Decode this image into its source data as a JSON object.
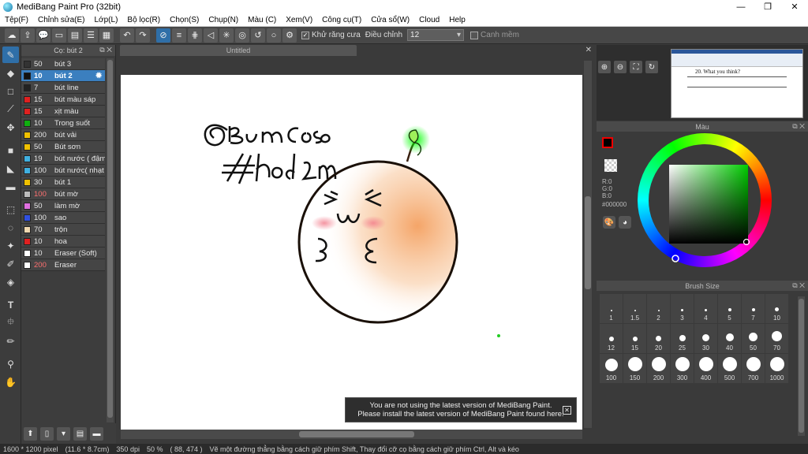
{
  "window": {
    "title": "MediBang Paint Pro (32bit)",
    "minimize": "—",
    "maximize": "❐",
    "close": "✕"
  },
  "menu": [
    "Tệp(F)",
    "Chỉnh sửa(E)",
    "Lớp(L)",
    "Bộ lọc(R)",
    "Chọn(S)",
    "Chụp(N)",
    "Màu (C)",
    "Xem(V)",
    "Công cụ(T)",
    "Cửa sổ(W)",
    "Cloud",
    "Help"
  ],
  "toolbar": {
    "antialias_label": "Khử răng cưa",
    "correction_label": "Điều chỉnh",
    "correction_value": "12",
    "edge_label": "Canh mềm"
  },
  "brush_panel": {
    "title": "Cọ: bút 2",
    "brushes": [
      {
        "size": "50",
        "name": "bút 3",
        "color": "#333333"
      },
      {
        "size": "10",
        "name": "bút 2",
        "color": "#111111",
        "selected": true
      },
      {
        "size": "7",
        "name": "bút line",
        "color": "#222222"
      },
      {
        "size": "15",
        "name": "bút màu sáp",
        "color": "#e02020"
      },
      {
        "size": "15",
        "name": "xịt màu",
        "color": "#e02020"
      },
      {
        "size": "10",
        "name": "Trong suốt",
        "color": "#10b010"
      },
      {
        "size": "200",
        "name": "bút vải",
        "color": "#f0c000"
      },
      {
        "size": "50",
        "name": "Bút sơn",
        "color": "#f0c000"
      },
      {
        "size": "19",
        "name": "bút nước ( đậm",
        "color": "#40b0e0"
      },
      {
        "size": "100",
        "name": "bút nước( nhạt",
        "color": "#40b0e0"
      },
      {
        "size": "30",
        "name": "bút 1",
        "color": "#f0c000"
      },
      {
        "size": "100",
        "name": "bút mờ",
        "color": "#bbbbbb",
        "red_size": true
      },
      {
        "size": "50",
        "name": "làm mờ",
        "color": "#e070e0"
      },
      {
        "size": "100",
        "name": "sao",
        "color": "#3050e0"
      },
      {
        "size": "70",
        "name": "trộn",
        "color": "#f0d8b0"
      },
      {
        "size": "10",
        "name": "hoa",
        "color": "#e02020"
      },
      {
        "size": "10",
        "name": "Eraser (Soft)",
        "color": "#ffffff"
      },
      {
        "size": "200",
        "name": "Eraser",
        "color": "#ffffff",
        "red_size": true
      }
    ]
  },
  "document": {
    "tab": "Untitled"
  },
  "notice": {
    "line1": "You are not using the latest version of MediBang Paint.",
    "line2": "Please install the latest version of MediBang Paint found here."
  },
  "navigator": {
    "preview_line": "20. What you think?"
  },
  "color_panel": {
    "title": "Màu",
    "r": "R:0",
    "g": "G:0",
    "b": "B:0",
    "hex": "#000000",
    "fg_color": "#000000",
    "accent": "#00cc00"
  },
  "brush_size_panel": {
    "title": "Brush Size",
    "sizes": [
      "1",
      "1.5",
      "2",
      "3",
      "4",
      "5",
      "7",
      "10",
      "12",
      "15",
      "20",
      "25",
      "30",
      "40",
      "50",
      "70",
      "100",
      "150",
      "200",
      "300",
      "400",
      "500",
      "700",
      "1000"
    ]
  },
  "status": {
    "size": "1600 * 1200 pixel",
    "cm": "(11.6 * 8.7cm)",
    "dpi": "350 dpi",
    "zoom": "50 %",
    "coords": "( 88, 474 )",
    "hint": "Vẽ một đường thẳng bằng cách giữ phím Shift, Thay đổi cỡ cọ bằng cách giữ phím Ctrl, Alt và kéo"
  }
}
